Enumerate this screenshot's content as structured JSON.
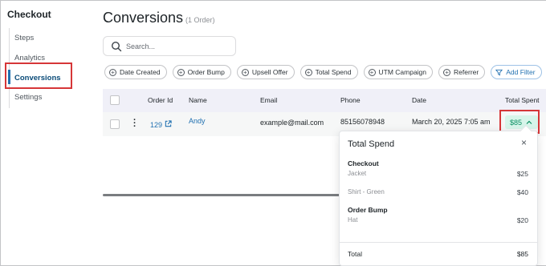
{
  "sidebar": {
    "title": "Checkout",
    "items": [
      {
        "label": "Steps"
      },
      {
        "label": "Analytics"
      },
      {
        "label": "Conversions"
      },
      {
        "label": "Settings"
      }
    ]
  },
  "main": {
    "title": "Conversions",
    "count": "(1 Order)",
    "search_placeholder": "Search...",
    "filters": [
      "Date Created",
      "Order Bump",
      "Upsell Offer",
      "Total Spend",
      "UTM Campaign",
      "Referrer"
    ],
    "add_filter": "Add Filter"
  },
  "table": {
    "headers": [
      "Order Id",
      "Name",
      "Email",
      "Phone",
      "Date",
      "Total Spent"
    ],
    "row": {
      "order_id": "129",
      "name": "Andy",
      "email": "example@mail.com",
      "phone": "85156078948",
      "date": "March 20, 2025 7:05 am",
      "total_spent": "$85"
    }
  },
  "popover": {
    "title": "Total Spend",
    "close": "×",
    "sections": [
      {
        "title": "Checkout",
        "items": [
          {
            "name": "Jacket",
            "amount": "$25"
          },
          {
            "name": "Shirt - Green",
            "amount": "$40"
          }
        ]
      },
      {
        "title": "Order Bump",
        "items": [
          {
            "name": "Hat",
            "amount": "$20"
          }
        ]
      }
    ],
    "total_label": "Total",
    "total_amount": "$85"
  },
  "colors": {
    "accent": "#2271b1",
    "highlight": "#d63638",
    "spent_bg": "#d7f5ea",
    "spent_text": "#0a8f62"
  }
}
